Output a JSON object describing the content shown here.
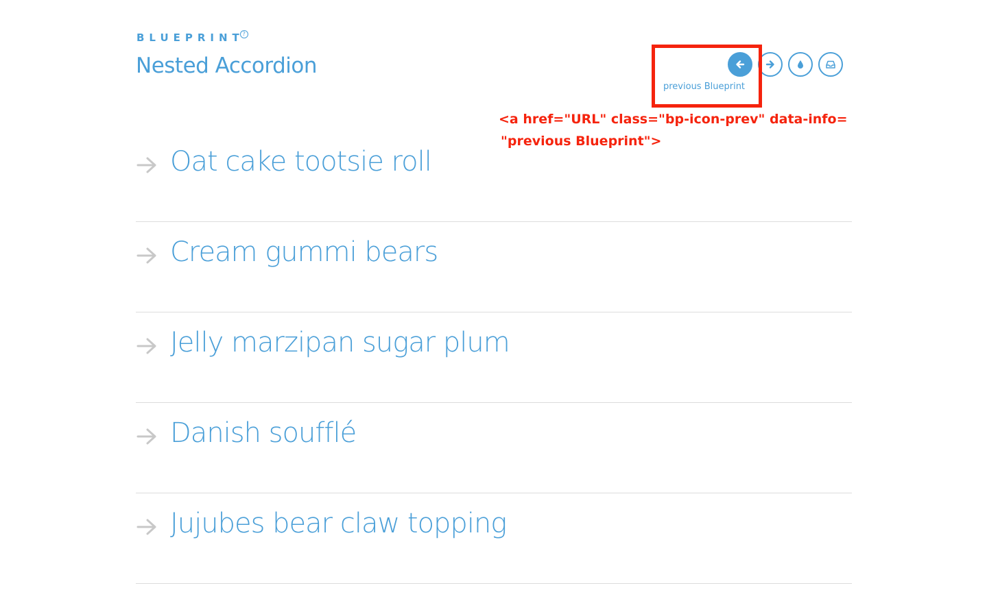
{
  "header": {
    "brand": "BLUEPRINT",
    "brand_help_glyph": "?",
    "title": "Nested Accordion"
  },
  "nav": {
    "buttons": [
      {
        "icon": "arrow-left-icon",
        "active": true
      },
      {
        "icon": "arrow-right-icon",
        "active": false
      },
      {
        "icon": "drop-icon",
        "active": false
      },
      {
        "icon": "inbox-icon",
        "active": false
      }
    ],
    "tooltip": "previous Blueprint"
  },
  "annotation": {
    "line1": "<a href=\"URL\" class=\"bp-icon-prev\" data-info=",
    "line2": "\"previous Blueprint\">"
  },
  "accordion": {
    "items": [
      {
        "title": "Oat cake tootsie roll"
      },
      {
        "title": "Cream gummi bears"
      },
      {
        "title": "Jelly marzipan sugar plum"
      },
      {
        "title": "Danish soufflé"
      },
      {
        "title": "Jujubes bear claw topping"
      }
    ]
  },
  "colors": {
    "accent": "#4a9fd8",
    "annotation": "#f5230d",
    "divider": "#dcdcdc",
    "arrow": "#c8c8c8"
  }
}
